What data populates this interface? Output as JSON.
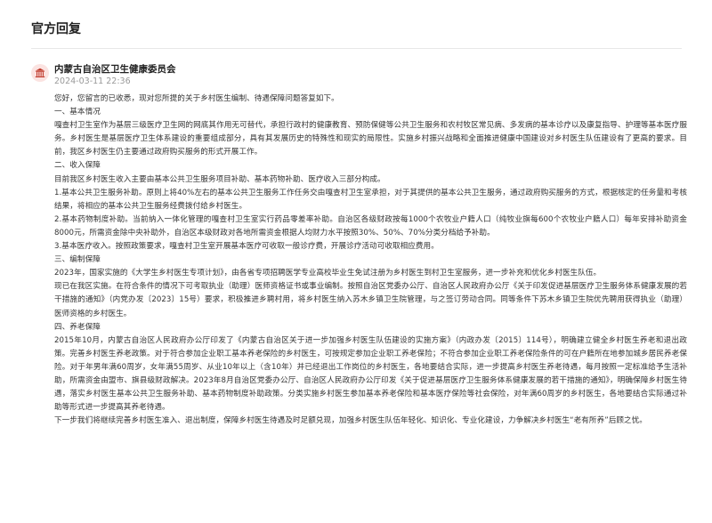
{
  "header": {
    "title": "官方回复"
  },
  "reply": {
    "org": "内蒙古自治区卫生健康委员会",
    "time": "2024-03-11 22:36",
    "paragraphs": [
      "您好，您留言的已收悉，现对您所提的关于乡村医生编制、待遇保障问题答复如下。",
      "一、基本情况",
      "嘎查村卫生室作为基层三级医疗卫生网的网底其作用无可替代，承担行政村的健康教育、预防保健等公共卫生服务和农村牧区常见病、多发病的基本诊疗以及康复指导、护理等基本医疗服务。乡村医生是基层医疗卫生体系建设的重要组成部分，具有其发展历史的特殊性和现实的局限性。实施乡村振兴战略和全面推进健康中国建设对乡村医生队伍建设有了更高的要求。目前，我区乡村医生仍主要通过政府购买服务的形式开展工作。",
      "二、收入保障",
      "目前我区乡村医生收入主要由基本公共卫生服务项目补助、基本药物补助、医疗收入三部分构成。",
      "1.基本公共卫生服务补助。原则上将40%左右的基本公共卫生服务工作任务交由嘎查村卫生室承担，对于其提供的基本公共卫生服务，通过政府购买服务的方式，根据核定的任务量和考核结果，将相应的基本公共卫生服务经费拨付给乡村医生。",
      "2.基本药物制度补助。当前纳入一体化管理的嘎查村卫生室实行药品零差率补助。自治区各级财政按每1000个农牧业户籍人口（纯牧业旗每600个农牧业户籍人口）每年安排补助资金8000元，所需资金除中央补助外，自治区本级财政对各地所需资金根据人均财力水平按照30%、50%、70%分类分档给予补助。",
      "3.基本医疗收入。按照政策要求，嘎查村卫生室开展基本医疗可收取一般诊疗费，开展诊疗活动可收取相应费用。",
      "三、编制保障",
      "2023年，国家实施的《大学生乡村医生专项计划》，由各省专项招聘医学专业高校毕业生免试注册为乡村医生到村卫生室服务，进一步补充和优化乡村医生队伍。",
      "现已在我区实施。在符合条件的情况下可考取执业（助理）医师资格证书或事业编制。按照自治区党委办公厅、自治区人民政府办公厅《关于印发促进基层医疗卫生服务体系健康发展的若干措施的通知》（内党办发〔2023〕15号）要求，积极推进乡聘村用，将乡村医生纳入苏木乡镇卫生院管理，与之签订劳动合同。同等条件下苏木乡镇卫生院优先聘用获得执业（助理）医师资格的乡村医生。",
      "四、养老保障",
      "2015年10月，内蒙古自治区人民政府办公厅印发了《内蒙古自治区关于进一步加强乡村医生队伍建设的实施方案》（内政办发〔2015〕114号），明确建立健全乡村医生养老和退出政策。完善乡村医生养老政策。对于符合参加企业职工基本养老保险的乡村医生，可按规定参加企业职工养老保险；不符合参加企业职工养老保险条件的可在户籍所在地参加城乡居民养老保险。对于年男年满60周岁，女年满55周岁、从业10年以上（含10年）并已经退出工作岗位的乡村医生，各地要结合实际，进一步提高乡村医生养老待遇，每月按照一定标准给予生活补助，所需资金由盟市、旗县级财政解决。2023年8月自治区党委办公厅、自治区人民政府办公厅印发《关于促进基层医疗卫生服务体系健康发展的若干措施的通知》，明确保障乡村医生待遇，落实乡村医生基本公共卫生服务补助、基本药物制度补助政策。分类实施乡村医生参加基本养老保险和基本医疗保险等社会保险，对年满60周岁的乡村医生，各地要结合实际通过补助等形式进一步提高其养老待遇。",
      "下一步我们将继续完善乡村医生准入、退出制度，保障乡村医生待遇及时足额兑现，加强乡村医生队伍年轻化、知识化、专业化建设，力争解决乡村医生“老有所养”后顾之忧。"
    ]
  },
  "colors": {
    "accent": "#c0392b",
    "avatar_bg": "#fbe3e1"
  }
}
